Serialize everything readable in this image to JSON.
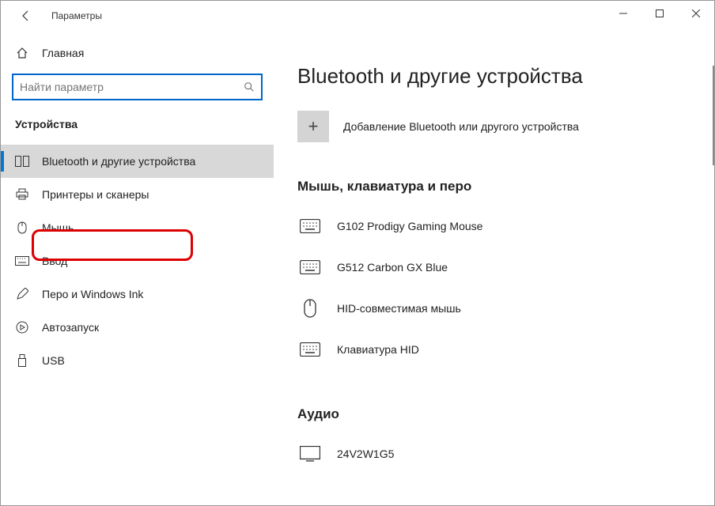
{
  "window": {
    "title": "Параметры"
  },
  "sidebar": {
    "home_label": "Главная",
    "search_placeholder": "Найти параметр",
    "section_title": "Устройства",
    "items": [
      {
        "label": "Bluetooth и другие устройства",
        "icon": "bluetooth-devices-icon"
      },
      {
        "label": "Принтеры и сканеры",
        "icon": "printer-icon"
      },
      {
        "label": "Мышь",
        "icon": "mouse-icon"
      },
      {
        "label": "Ввод",
        "icon": "keyboard-icon"
      },
      {
        "label": "Перо и Windows Ink",
        "icon": "pen-icon"
      },
      {
        "label": "Автозапуск",
        "icon": "autoplay-icon"
      },
      {
        "label": "USB",
        "icon": "usb-icon"
      }
    ]
  },
  "main": {
    "page_title": "Bluetooth и другие устройства",
    "add_label": "Добавление Bluetooth или другого устройства",
    "groups": [
      {
        "title": "Мышь, клавиатура и перо",
        "devices": [
          {
            "label": "G102 Prodigy Gaming Mouse",
            "icon": "keyboard-dev-icon"
          },
          {
            "label": "G512 Carbon GX Blue",
            "icon": "keyboard-dev-icon"
          },
          {
            "label": "HID-совместимая мышь",
            "icon": "mouse-dev-icon"
          },
          {
            "label": "Клавиатура HID",
            "icon": "keyboard-dev-icon"
          }
        ]
      },
      {
        "title": "Аудио",
        "devices": [
          {
            "label": "24V2W1G5",
            "icon": "monitor-dev-icon"
          }
        ]
      }
    ]
  }
}
